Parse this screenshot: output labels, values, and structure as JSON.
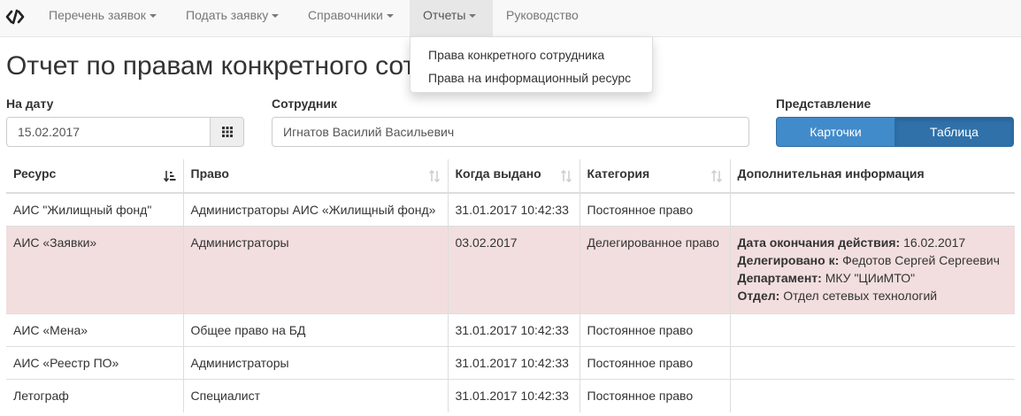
{
  "navbar": {
    "brand_icon": "code-icon",
    "items": [
      {
        "label": "Перечень заявок",
        "dropdown": true
      },
      {
        "label": "Подать заявку",
        "dropdown": true
      },
      {
        "label": "Справочники",
        "dropdown": true
      },
      {
        "label": "Отчеты",
        "dropdown": true,
        "active": true
      },
      {
        "label": "Руководство",
        "dropdown": false
      }
    ],
    "reports_menu": [
      "Права конкретного сотрудника",
      "Права на информационный ресурс"
    ]
  },
  "page": {
    "title": "Отчет по правам конкретного сотрудника"
  },
  "form": {
    "date_label": "На дату",
    "date_value": "15.02.2017",
    "calendar_icon": "calendar-grid-icon",
    "employee_label": "Сотрудник",
    "employee_value": "Игнатов Василий Васильевич",
    "view_label": "Представление",
    "view_options": [
      "Карточки",
      "Таблица"
    ],
    "view_selected": "Таблица"
  },
  "table": {
    "columns": [
      {
        "label": "Ресурс",
        "sort": "sort-alpha-active-icon"
      },
      {
        "label": "Право",
        "sort": "sort-icon"
      },
      {
        "label": "Когда выдано",
        "sort": "sort-icon"
      },
      {
        "label": "Категория",
        "sort": "sort-icon"
      },
      {
        "label": "Дополнительная информация",
        "sort": ""
      }
    ],
    "rows": [
      {
        "resource": "АИС \"Жилищный фонд\"",
        "right": "Администраторы АИС «Жилищный фонд»",
        "issued": "31.01.2017 10:42:33",
        "category": "Постоянное право",
        "info": [],
        "highlight": false
      },
      {
        "resource": "АИС «Заявки»",
        "right": "Администраторы",
        "issued": "03.02.2017",
        "category": "Делегированное право",
        "highlight": true,
        "info": [
          {
            "key": "Дата окончания действия:",
            "value": "16.02.2017"
          },
          {
            "key": "Делегировано к:",
            "value": "Федотов Сергей Сергеевич"
          },
          {
            "key": "Департамент:",
            "value": "МКУ \"ЦИиМТО\""
          },
          {
            "key": "Отдел:",
            "value": "Отдел сетевых технологий"
          }
        ]
      },
      {
        "resource": "АИС «Мена»",
        "right": "Общее право на БД",
        "issued": "31.01.2017 10:42:33",
        "category": "Постоянное право",
        "info": [],
        "highlight": false
      },
      {
        "resource": "АИС «Реестр ПО»",
        "right": "Администраторы",
        "issued": "31.01.2017 10:42:33",
        "category": "Постоянное право",
        "info": [],
        "highlight": false
      },
      {
        "resource": "Летограф",
        "right": "Специалист",
        "issued": "31.01.2017 10:42:33",
        "category": "Постоянное право",
        "info": [],
        "highlight": false
      }
    ]
  },
  "colors": {
    "navbar_bg": "#f8f8f8",
    "active_nav_bg": "#e7e7e7",
    "primary": "#428bca",
    "primary_active": "#3071a9",
    "danger_row_bg": "#f2dede"
  }
}
